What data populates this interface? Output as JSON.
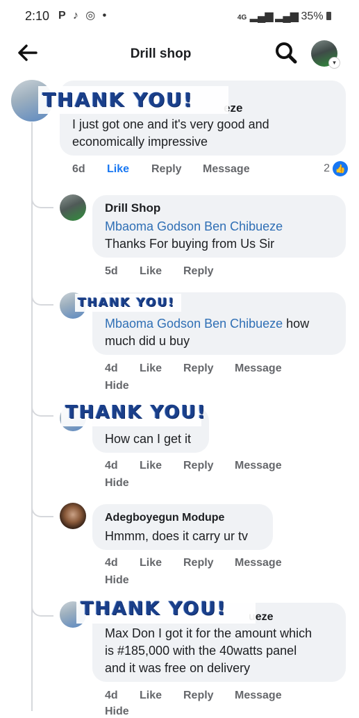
{
  "status_bar": {
    "time": "2:10",
    "icons": "P ♪ ◎ •",
    "network": "4G",
    "battery": "35%"
  },
  "header": {
    "title": "Drill shop"
  },
  "overlay_text": "THANK YOU!",
  "comments": [
    {
      "author": "eze",
      "text_lines": [
        "I just got one and it's very good and",
        "economically impressive"
      ],
      "time": "6d",
      "like": "Like",
      "reply": "Reply",
      "message": "Message",
      "reaction_count": "2"
    },
    {
      "author": "Drill Shop",
      "mention": "Mbaoma Godson Ben Chibueze",
      "text": "Thanks For buying from Us Sir",
      "time": "5d",
      "like": "Like",
      "reply": "Reply"
    },
    {
      "mention": "Mbaoma Godson Ben Chibueze",
      "text_after_mention": " how",
      "text_line2": "much did u buy",
      "time": "4d",
      "like": "Like",
      "reply": "Reply",
      "message": "Message",
      "hide": "Hide"
    },
    {
      "text": "How can I get it",
      "time": "4d",
      "like": "Like",
      "reply": "Reply",
      "message": "Message",
      "hide": "Hide"
    },
    {
      "author": "Adegboyegun Modupe",
      "text": "Hmmm, does it carry ur tv",
      "time": "4d",
      "like": "Like",
      "reply": "Reply",
      "message": "Message",
      "hide": "Hide"
    },
    {
      "author": "ueze",
      "text_lines": [
        "Max Don I got it for the amount which",
        "is #185,000 with the 40watts panel",
        "and it was free on delivery"
      ],
      "time": "4d",
      "like": "Like",
      "reply": "Reply",
      "message": "Message",
      "hide": "Hide"
    }
  ]
}
